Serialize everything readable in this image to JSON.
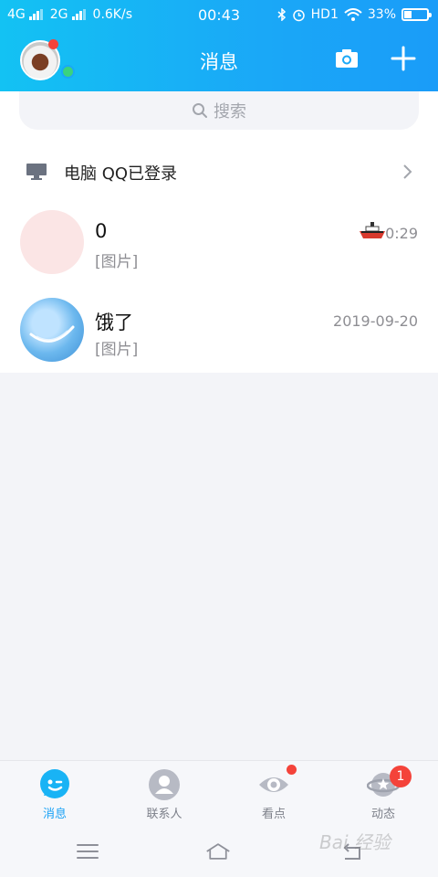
{
  "status_bar": {
    "left": "4G",
    "left2": "2G",
    "speed": "0.6K/s",
    "time": "00:43",
    "hd": "HD1",
    "battery_text": "33%",
    "battery_level": 0.33
  },
  "header": {
    "title": "消息"
  },
  "search": {
    "placeholder": "搜索"
  },
  "pc_login": {
    "label": "电脑 QQ已登录"
  },
  "chats": [
    {
      "name": "0",
      "message": "[图片]",
      "time": "0:29"
    },
    {
      "name": "饿了",
      "message": "[图片]",
      "time": "2019-09-20"
    }
  ],
  "tabs": [
    {
      "label": "消息"
    },
    {
      "label": "联系人"
    },
    {
      "label": "看点"
    },
    {
      "label": "动态",
      "badge": "1"
    }
  ],
  "watermark": "Bai 经验",
  "colors": {
    "accent": "#1aa2f5",
    "badge": "#f4433a",
    "online": "#3ad37f"
  }
}
